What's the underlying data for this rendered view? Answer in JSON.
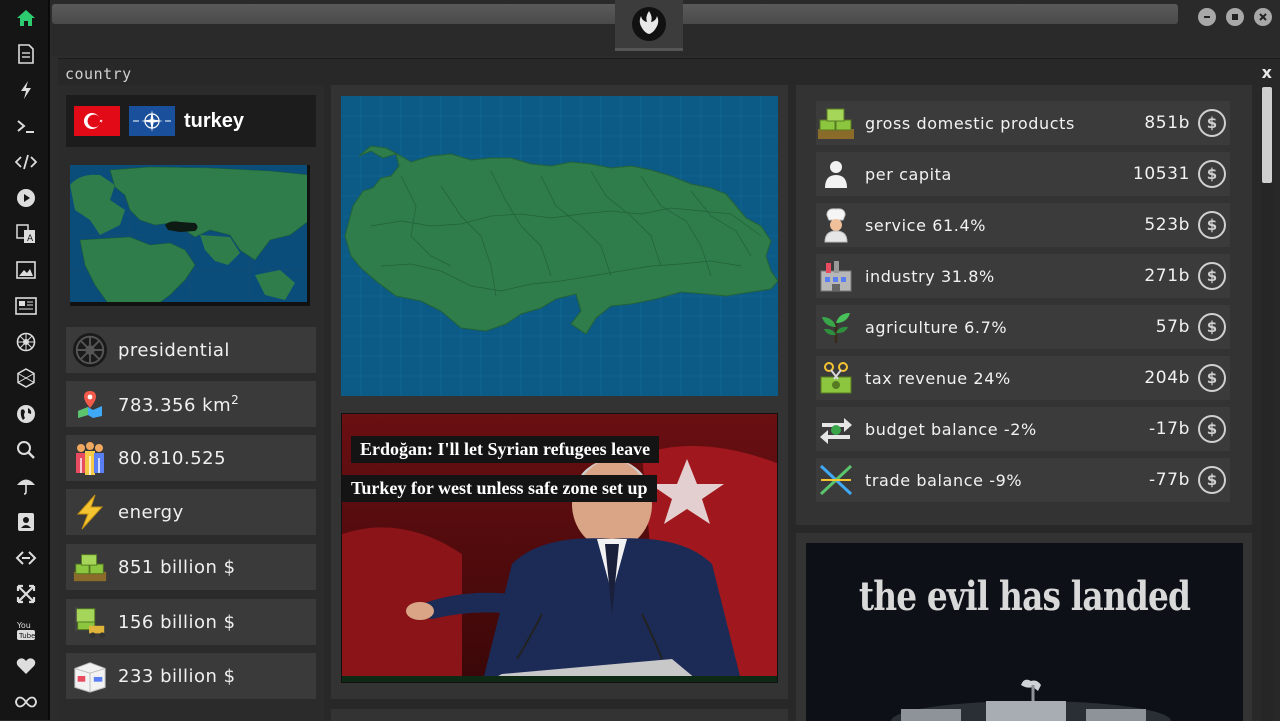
{
  "window": {
    "panel_title": "country",
    "close_label": "x"
  },
  "sidebar": {
    "items": [
      {
        "icon": "home-icon",
        "color": "#2ecc71"
      },
      {
        "icon": "document-icon"
      },
      {
        "icon": "lightning-icon"
      },
      {
        "icon": "terminal-icon"
      },
      {
        "icon": "code-icon"
      },
      {
        "icon": "play-icon"
      },
      {
        "icon": "translate-icon"
      },
      {
        "icon": "image-icon"
      },
      {
        "icon": "newspaper-icon"
      },
      {
        "icon": "empire-icon"
      },
      {
        "icon": "hexagon-icon"
      },
      {
        "icon": "globe-icon"
      },
      {
        "icon": "search-icon"
      },
      {
        "icon": "umbrella-icon"
      },
      {
        "icon": "contact-icon"
      },
      {
        "icon": "chain-icon"
      },
      {
        "icon": "expand-icon"
      },
      {
        "icon": "youtube-icon"
      },
      {
        "icon": "heart-icon"
      },
      {
        "icon": "infinity-icon"
      }
    ]
  },
  "country": {
    "name": "turkey",
    "government": "presidential",
    "area_value": "783.356 km",
    "area_sup": "2",
    "population": "80.810.525",
    "main_resource": "energy",
    "gdp": "851 billion $",
    "exports": "156 billion $",
    "imports": "233 billion $"
  },
  "news": {
    "headline_line1": "Erdoğan: I'll let Syrian refugees leave",
    "headline_line2": "Turkey for west unless safe zone set up"
  },
  "economy": {
    "rows": [
      {
        "label": "gross domestic products",
        "value": "851b",
        "icon": "money-stack-icon"
      },
      {
        "label": "per capita",
        "value": "10531",
        "icon": "person-icon"
      },
      {
        "label": "service 61.4%",
        "value": "523b",
        "icon": "chef-icon"
      },
      {
        "label": "industry 31.8%",
        "value": "271b",
        "icon": "factory-icon"
      },
      {
        "label": "agriculture 6.7%",
        "value": "57b",
        "icon": "plant-icon"
      },
      {
        "label": "tax revenue 24%",
        "value": "204b",
        "icon": "cash-scissors-icon"
      },
      {
        "label": "budget balance -2%",
        "value": "-17b",
        "icon": "balance-arrows-icon"
      },
      {
        "label": "trade balance -9%",
        "value": "-77b",
        "icon": "trade-cross-icon"
      }
    ],
    "currency_symbol": "$"
  },
  "promo": {
    "title": "the evil has landed"
  },
  "colors": {
    "accent_green": "#2ecc71",
    "map_water": "#0c5a86",
    "map_land": "#2e7d4a"
  }
}
